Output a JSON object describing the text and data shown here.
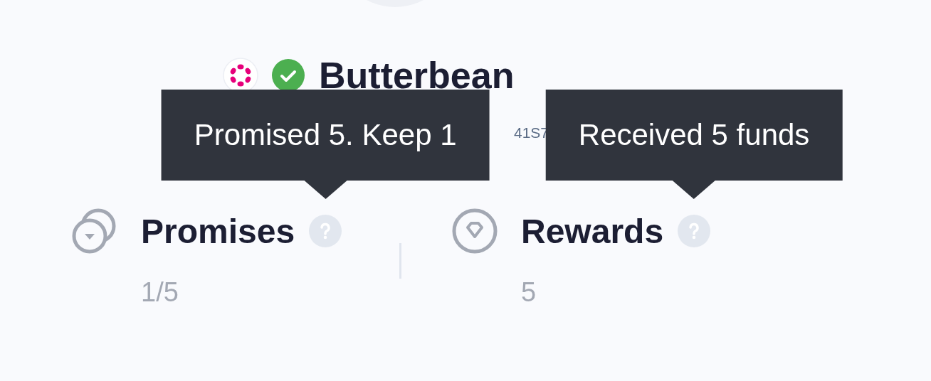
{
  "profile": {
    "name": "Butterbean",
    "verified": true,
    "address_fragment": "41S7"
  },
  "stats": [
    {
      "kind": "promises",
      "label": "Promises",
      "value": "1/5",
      "tooltip": "Promised 5. Keep 1"
    },
    {
      "kind": "rewards",
      "label": "Rewards",
      "value": "5",
      "tooltip": "Received 5 funds"
    }
  ]
}
